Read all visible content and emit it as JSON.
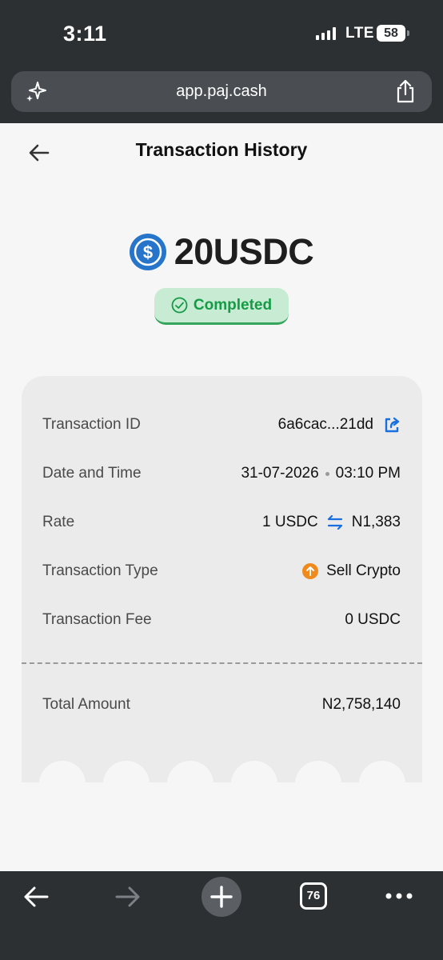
{
  "status_bar": {
    "time": "3:11",
    "network": "LTE",
    "battery": "58"
  },
  "browser": {
    "url": "app.paj.cash",
    "tab_count": "76"
  },
  "page": {
    "title": "Transaction History"
  },
  "transaction": {
    "amount": "20USDC",
    "status": "Completed",
    "details": [
      {
        "label": "Transaction ID",
        "value": "6a6cac...21dd"
      },
      {
        "label": "Date and Time",
        "date": "31-07-2026",
        "time": "03:10 PM"
      },
      {
        "label": "Rate",
        "from": "1 USDC",
        "to": "N1,383"
      },
      {
        "label": "Transaction Type",
        "value": "Sell Crypto"
      },
      {
        "label": "Transaction Fee",
        "value": "0 USDC"
      }
    ],
    "total": {
      "label": "Total Amount",
      "value": "N2,758,140"
    }
  },
  "colors": {
    "chrome_bg": "#2c3033",
    "usdc_blue": "#2775ca",
    "success_green": "#169a46",
    "badge_bg": "#c7ecd3",
    "link_blue": "#1a6fe0",
    "sell_orange": "#f08a1d"
  },
  "icons": [
    "sparkle-icon",
    "share-icon",
    "back-arrow-icon",
    "usdc-icon",
    "check-circle-icon",
    "copy-link-icon",
    "swap-arrows-icon",
    "sell-arrow-icon",
    "forward-arrow-icon",
    "plus-icon",
    "more-icon"
  ]
}
